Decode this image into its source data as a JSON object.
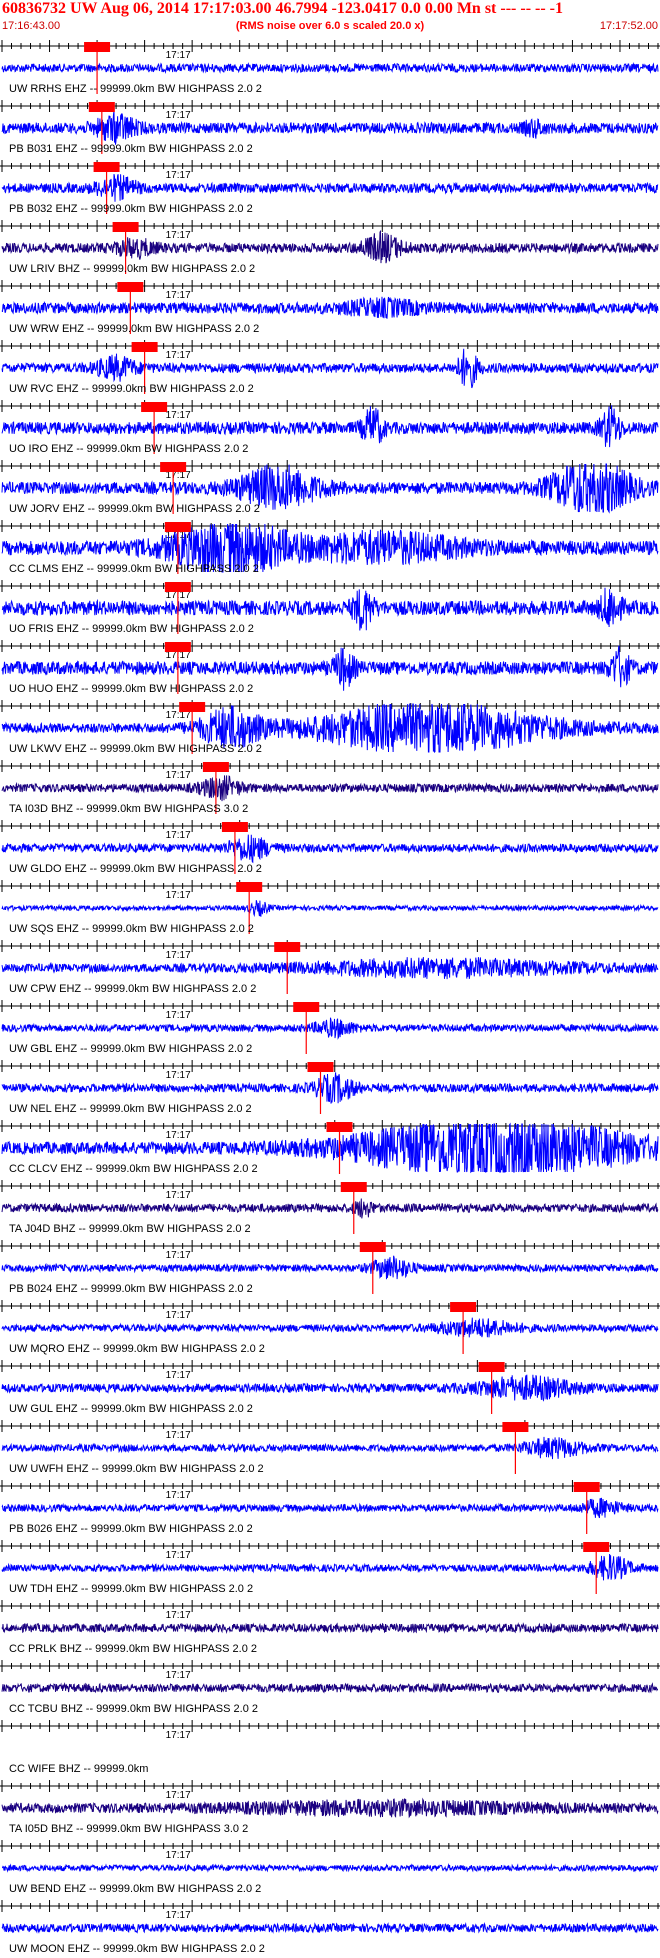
{
  "header": {
    "title": "60836732 UW Aug 06, 2014 17:17:03.00   46.7994 -123.0417  0.0 0.00 Mn st --- -- --  -1",
    "start_time": "17:16:43.00",
    "note": "(RMS noise over 6.0 s scaled 20.0 x)",
    "end_time": "17:17:52.00"
  },
  "colors": {
    "background": "#ffffff",
    "trace": "#0000ff",
    "trace_dark": "#1a0080",
    "title": "#ff0000",
    "pick_line": "#ff0000",
    "pick_box": "#ff0000",
    "pick_text": "#000000",
    "grid": "#000000"
  },
  "chart_data": {
    "type": "line",
    "x_range_seconds": [
      0,
      69
    ],
    "minute_marker": "17:17",
    "minute_marker_offset_s": 17,
    "traces": [
      {
        "label": "UW RRHS EHZ -- 99999.0km BW  HIGHPASS  2.0  2",
        "pick": "",
        "pick_offset_s": 10.0,
        "dark": false,
        "amp": 0.35,
        "bursts": []
      },
      {
        "label": "PB B031 EHZ -- 99999.0km BW  HIGHPASS  2.0  2",
        "pick": "",
        "pick_offset_s": 10.5,
        "dark": false,
        "amp": 0.45,
        "bursts": [
          {
            "t": 12,
            "w": 2,
            "a": 1.0
          },
          {
            "t": 56,
            "w": 1,
            "a": 0.5
          }
        ]
      },
      {
        "label": "PB B032 EHZ -- 99999.0km BW  HIGHPASS  2.0  2",
        "pick": "",
        "pick_offset_s": 11.0,
        "dark": false,
        "amp": 0.4,
        "bursts": [
          {
            "t": 12,
            "w": 2,
            "a": 0.8
          }
        ]
      },
      {
        "label": "UW LRIV BHZ -- 99999.0km BW  HIGHPASS  2.0  2",
        "pick": "",
        "pick_offset_s": 13.0,
        "dark": true,
        "amp": 0.4,
        "bursts": [
          {
            "t": 40,
            "w": 2,
            "a": 1.0
          },
          {
            "t": 14,
            "w": 2,
            "a": 0.6
          }
        ]
      },
      {
        "label": "UW WRW EHZ -- 99999.0km BW  HIGHPASS  2.0  2",
        "pick": "",
        "pick_offset_s": 13.5,
        "dark": false,
        "amp": 0.45,
        "bursts": [
          {
            "t": 40,
            "w": 4,
            "a": 0.5
          }
        ]
      },
      {
        "label": "UW RVC EHZ -- 99999.0km BW  HIGHPASS  2.0  2",
        "pick": "",
        "pick_offset_s": 15.0,
        "dark": false,
        "amp": 0.4,
        "bursts": [
          {
            "t": 49,
            "w": 1,
            "a": 1.5
          },
          {
            "t": 12,
            "w": 2,
            "a": 0.8
          }
        ]
      },
      {
        "label": "UO IRO EHZ -- 99999.0km BW  HIGHPASS  2.0  2",
        "pick": "",
        "pick_offset_s": 16.0,
        "dark": false,
        "amp": 0.5,
        "bursts": [
          {
            "t": 39,
            "w": 1,
            "a": 1.5
          },
          {
            "t": 64,
            "w": 1,
            "a": 1.5
          }
        ]
      },
      {
        "label": "UW JORV EHZ -- 99999.0km BW  HIGHPASS  2.0  2",
        "pick": "",
        "pick_offset_s": 18.0,
        "dark": false,
        "amp": 0.5,
        "bursts": [
          {
            "t": 29,
            "w": 4,
            "a": 1.6
          },
          {
            "t": 62,
            "w": 4,
            "a": 2.2
          }
        ]
      },
      {
        "label": "CC CLMS EHZ -- 99999.0km BW  HIGHPASS  2.0  2",
        "pick": "",
        "pick_offset_s": 18.5,
        "dark": false,
        "amp": 0.6,
        "bursts": [
          {
            "t": 24,
            "w": 6,
            "a": 2.0
          },
          {
            "t": 40,
            "w": 8,
            "a": 1.0
          }
        ]
      },
      {
        "label": "UO FRIS EHZ -- 99999.0km BW  HIGHPASS  2.0  2",
        "pick": "",
        "pick_offset_s": 18.5,
        "dark": false,
        "amp": 0.6,
        "bursts": [
          {
            "t": 38,
            "w": 1,
            "a": 1.5
          },
          {
            "t": 64,
            "w": 1,
            "a": 1.5
          }
        ]
      },
      {
        "label": "UO HUO EHZ -- 99999.0km BW  HIGHPASS  2.0  2",
        "pick": "",
        "pick_offset_s": 18.5,
        "dark": false,
        "amp": 0.55,
        "bursts": [
          {
            "t": 36,
            "w": 1,
            "a": 1.4
          },
          {
            "t": 65,
            "w": 1,
            "a": 1.4
          }
        ]
      },
      {
        "label": "UW LKWV EHZ -- 99999.0km BW  HIGHPASS  2.0  2",
        "pick": "",
        "pick_offset_s": 20.0,
        "dark": false,
        "amp": 0.4,
        "bursts": [
          {
            "t": 24,
            "w": 3,
            "a": 1.5
          },
          {
            "t": 45,
            "w": 12,
            "a": 2.0
          }
        ]
      },
      {
        "label": "TA I03D BHZ -- 99999.0km BW  HIGHPASS  3.0  2",
        "pick": "",
        "pick_offset_s": 22.5,
        "dark": true,
        "amp": 0.35,
        "bursts": [
          {
            "t": 23,
            "w": 2,
            "a": 0.8
          }
        ]
      },
      {
        "label": "UW GLDO EHZ -- 99999.0km BW  HIGHPASS  2.0  2",
        "pick": "",
        "pick_offset_s": 24.5,
        "dark": false,
        "amp": 0.35,
        "bursts": [
          {
            "t": 26,
            "w": 2,
            "a": 0.9
          }
        ]
      },
      {
        "label": "UW SQS EHZ -- 99999.0km BW  HIGHPASS  2.0  2",
        "pick": "",
        "pick_offset_s": 26.0,
        "dark": false,
        "amp": 0.2,
        "bursts": [
          {
            "t": 27,
            "w": 1,
            "a": 0.5
          }
        ]
      },
      {
        "label": "UW CPW EHZ -- 99999.0km BW  HIGHPASS  2.0  2",
        "pick": "",
        "pick_offset_s": 30.0,
        "dark": false,
        "amp": 0.35,
        "bursts": [
          {
            "t": 46,
            "w": 14,
            "a": 0.6
          }
        ]
      },
      {
        "label": "UW GBL EHZ -- 99999.0km BW  HIGHPASS  2.0  2",
        "pick": "",
        "pick_offset_s": 32.0,
        "dark": false,
        "amp": 0.3,
        "bursts": [
          {
            "t": 35,
            "w": 2,
            "a": 0.6
          }
        ]
      },
      {
        "label": "UW NEL EHZ -- 99999.0km BW  HIGHPASS  2.0  2",
        "pick": "",
        "pick_offset_s": 33.5,
        "dark": false,
        "amp": 0.35,
        "bursts": [
          {
            "t": 35,
            "w": 2,
            "a": 1.0
          }
        ]
      },
      {
        "label": "CC CLCV EHZ -- 99999.0km BW  HIGHPASS  2.0  2",
        "pick": "",
        "pick_offset_s": 35.5,
        "dark": false,
        "amp": 0.5,
        "bursts": [
          {
            "t": 52,
            "w": 14,
            "a": 2.4
          }
        ]
      },
      {
        "label": "TA J04D BHZ -- 99999.0km BW  HIGHPASS  2.0  2",
        "pick": "",
        "pick_offset_s": 37.0,
        "dark": true,
        "amp": 0.35,
        "bursts": [
          {
            "t": 38,
            "w": 1,
            "a": 0.6
          }
        ]
      },
      {
        "label": "PB B024 EHZ -- 99999.0km BW  HIGHPASS  2.0  2",
        "pick": "",
        "pick_offset_s": 39.0,
        "dark": false,
        "amp": 0.3,
        "bursts": [
          {
            "t": 41,
            "w": 2,
            "a": 0.8
          }
        ]
      },
      {
        "label": "UW MQRO EHZ -- 99999.0km BW  HIGHPASS  2.0  2",
        "pick": "",
        "pick_offset_s": 48.5,
        "dark": false,
        "amp": 0.3,
        "bursts": [
          {
            "t": 50,
            "w": 4,
            "a": 0.6
          }
        ]
      },
      {
        "label": "UW GUL EHZ -- 99999.0km BW  HIGHPASS  2.0  2",
        "pick": "",
        "pick_offset_s": 51.5,
        "dark": false,
        "amp": 0.35,
        "bursts": [
          {
            "t": 55,
            "w": 5,
            "a": 0.8
          }
        ]
      },
      {
        "label": "UW UWFH EHZ -- 99999.0km BW  HIGHPASS  2.0  2",
        "pick": "",
        "pick_offset_s": 54.0,
        "dark": false,
        "amp": 0.3,
        "bursts": [
          {
            "t": 58,
            "w": 3,
            "a": 0.7
          }
        ]
      },
      {
        "label": "PB B026 EHZ -- 99999.0km BW  HIGHPASS  2.0  2",
        "pick": "",
        "pick_offset_s": 61.5,
        "dark": false,
        "amp": 0.3,
        "bursts": [
          {
            "t": 63,
            "w": 2,
            "a": 0.6
          }
        ]
      },
      {
        "label": "UW TDH EHZ -- 99999.0km BW  HIGHPASS  2.0  2",
        "pick": "",
        "pick_offset_s": 62.5,
        "dark": false,
        "amp": 0.3,
        "bursts": [
          {
            "t": 64,
            "w": 2,
            "a": 0.9
          }
        ]
      },
      {
        "label": "CC PRLK BHZ -- 99999.0km BW  HIGHPASS  2.0  2",
        "pick": "",
        "pick_offset_s": null,
        "dark": true,
        "amp": 0.35,
        "bursts": []
      },
      {
        "label": "CC TCBU BHZ -- 99999.0km BW  HIGHPASS  2.0  2",
        "pick": "",
        "pick_offset_s": null,
        "dark": true,
        "amp": 0.35,
        "bursts": []
      },
      {
        "label": "CC WIFE BHZ -- 99999.0km",
        "pick": "",
        "pick_offset_s": null,
        "dark": false,
        "amp": 0.0,
        "bursts": []
      },
      {
        "label": "TA I05D BHZ -- 99999.0km BW  HIGHPASS  3.0  2",
        "pick": "",
        "pick_offset_s": null,
        "dark": true,
        "amp": 0.4,
        "bursts": [
          {
            "t": 40,
            "w": 15,
            "a": 0.4
          }
        ]
      },
      {
        "label": "UW BEND EHZ -- 99999.0km BW  HIGHPASS  2.0  2",
        "pick": "",
        "pick_offset_s": null,
        "dark": false,
        "amp": 0.25,
        "bursts": []
      },
      {
        "label": "UW MOON EHZ -- 99999.0km BW  HIGHPASS  2.0  2",
        "pick": "",
        "pick_offset_s": null,
        "dark": false,
        "amp": 0.35,
        "bursts": []
      }
    ]
  }
}
